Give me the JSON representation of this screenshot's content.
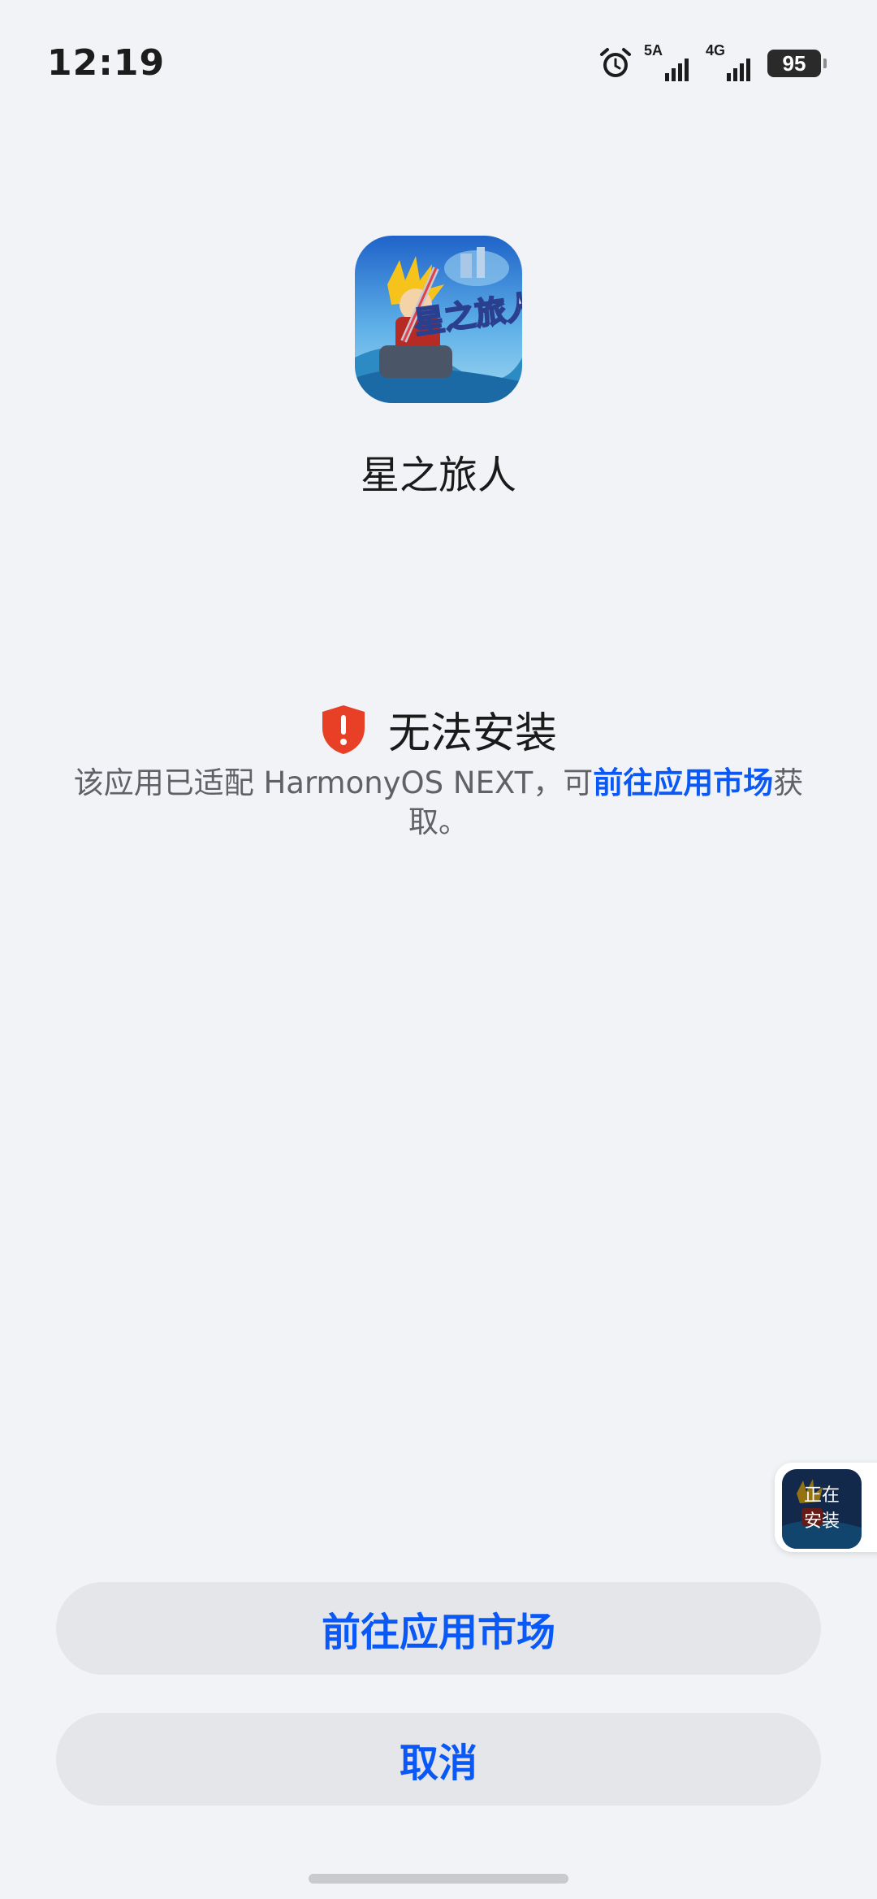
{
  "status_bar": {
    "time": "12:19",
    "network_1": "5A",
    "network_2": "4G",
    "battery": "95",
    "icons": [
      "alarm-icon",
      "signal-5a-icon",
      "signal-4g-icon",
      "battery-icon"
    ]
  },
  "app": {
    "name": "星之旅人",
    "icon": "app-icon"
  },
  "error": {
    "title": "无法安装",
    "icon": "shield-warning-icon",
    "icon_color": "#e84026",
    "desc_before": "该应用已适配 HarmonyOS NEXT，可",
    "desc_link": "前往应用市场",
    "desc_after": "获取。"
  },
  "installing_chip": {
    "label": "正在\n安装"
  },
  "buttons": {
    "market": "前往应用市场",
    "cancel": "取消"
  },
  "colors": {
    "accent": "#0a59f7",
    "background": "#f1f3f6",
    "button_bg": "#e5e6e9"
  }
}
